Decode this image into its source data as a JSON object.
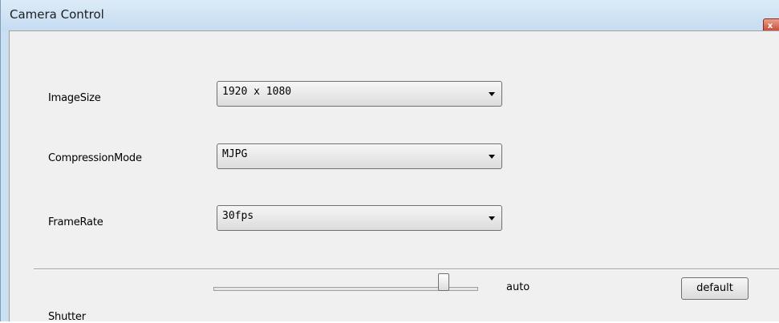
{
  "window": {
    "title": "Camera Control",
    "close_glyph": "x"
  },
  "fields": {
    "image_size": {
      "label": "ImageSize",
      "value": "1920 x 1080"
    },
    "compression_mode": {
      "label": "CompressionMode",
      "value": "MJPG"
    },
    "frame_rate": {
      "label": "FrameRate",
      "value": "30fps"
    }
  },
  "shutter": {
    "label": "Shutter",
    "mode_text": "auto",
    "default_label": "default"
  },
  "icons": {
    "dropdown": "chevron-down-icon",
    "close": "close-icon"
  },
  "colors": {
    "titlebar": "#c5dcf1",
    "client_bg": "#f0f0f0",
    "close_button": "#c7432e"
  }
}
